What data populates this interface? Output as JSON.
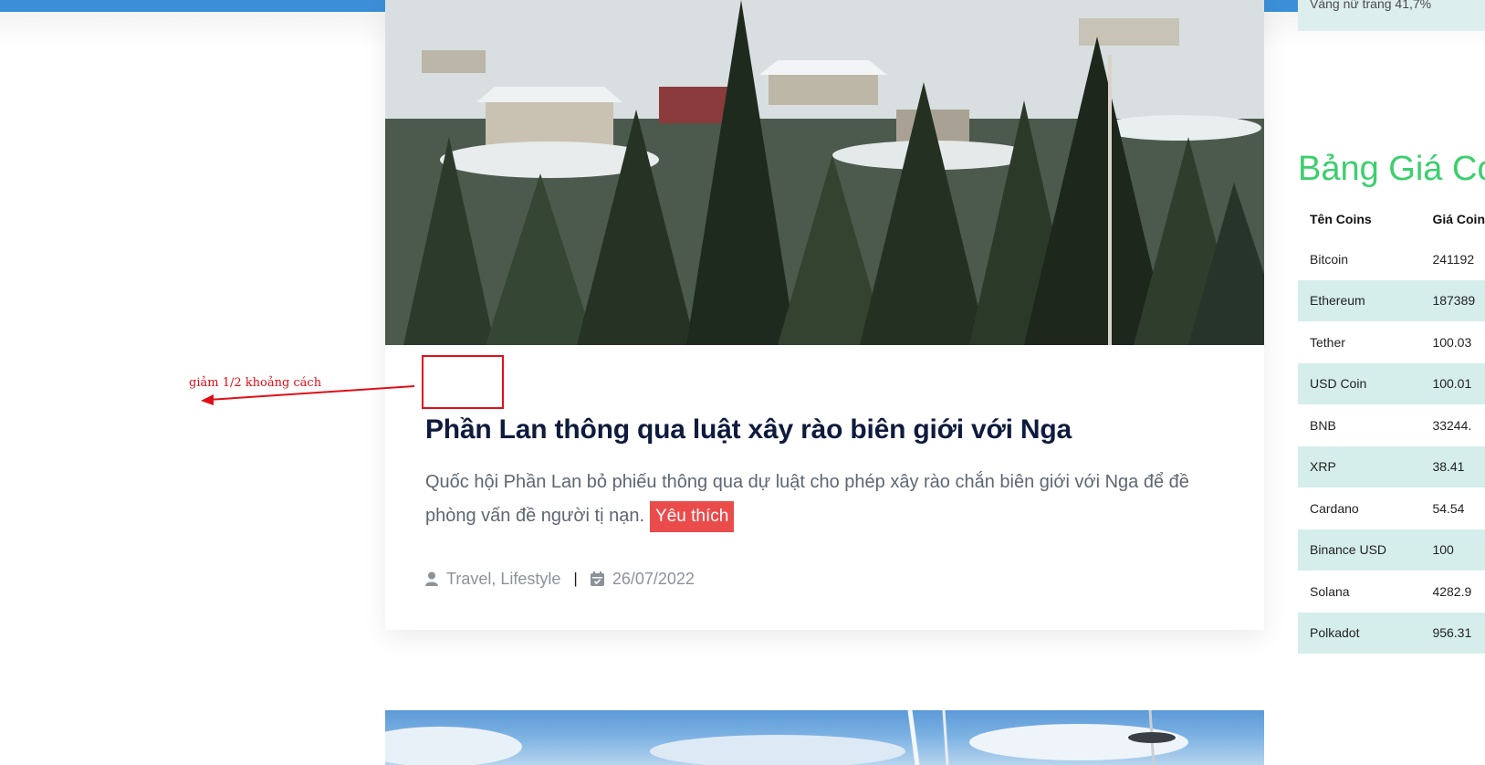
{
  "article": {
    "title": "Phần Lan thông qua luật xây rào biên giới với Nga",
    "excerpt": "Quốc hội Phần Lan bỏ phiếu thông qua dự luật cho phép xây rào chắn biên giới với Nga để đề phòng vấn đề người tị nạn.",
    "like_label": "Yêu thích",
    "categories": "Travel, Lifestyle",
    "separator": "|",
    "date": "26/07/2022"
  },
  "annotation": {
    "text": "giảm 1/2 khoảng cách",
    "color": "#e00f17"
  },
  "sidebar": {
    "top_snippet": "Vàng nữ trang 41,7%",
    "title": "Bảng Giá Coin",
    "columns": [
      "Tên Coins",
      "Giá Coin"
    ],
    "rows": [
      [
        "Bitcoin",
        "241192"
      ],
      [
        "Ethereum",
        "187389"
      ],
      [
        "Tether",
        "100.03"
      ],
      [
        "USD Coin",
        "100.01"
      ],
      [
        "BNB",
        "33244."
      ],
      [
        "XRP",
        "38.41"
      ],
      [
        "Cardano",
        "54.54"
      ],
      [
        "Binance USD",
        "100"
      ],
      [
        "Solana",
        "4282.9"
      ],
      [
        "Polkadot",
        "956.31"
      ]
    ]
  },
  "colors": {
    "topbar": "#3b8fd6",
    "title": "#0e1b3d",
    "accent_green": "#3ccf6e",
    "badge_red": "#ea4b4b",
    "row_alt": "#d5eeeb"
  },
  "icons": [
    "user-icon",
    "calendar-icon"
  ]
}
